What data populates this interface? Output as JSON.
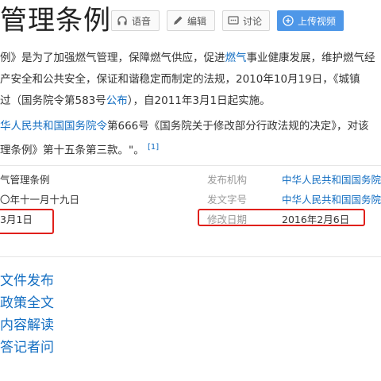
{
  "header": {
    "title": "管理条例",
    "buttons": {
      "voice": "语音",
      "edit": "编辑",
      "discuss": "讨论",
      "upload": "上传视频"
    }
  },
  "intro": {
    "line1": "例》是为了加强燃气管理，保障燃气供应，促进燃气事业健康发展，维护燃气经",
    "line1_link": "燃气",
    "line2": "产安全和公共安全，保证和谐稳定而制定的法规，2010年10月19日，《城镇",
    "line3_a": "过（国务院令第583号",
    "line3_link": "公布",
    "line3_b": "），自2011年3月1日起实施。"
  },
  "amend": {
    "link": "华人民共和国国务院令",
    "text1": "第666号《国务院关于修改部分行政法规的决定》，对该",
    "text2": "理条例》第十五条第三款。\"。",
    "ref": "[1]"
  },
  "info": {
    "left": [
      "气管理条例",
      "〇年十一月十九日",
      "3月1日"
    ],
    "right_labels": [
      "发布机构",
      "发文字号",
      "修改日期"
    ],
    "right_values": [
      "中华人民共和国国务院令",
      "中华人民共和国国务院令",
      "2016年2月6日"
    ]
  },
  "related_links": [
    "文件发布",
    "政策全文",
    "内容解读",
    "答记者问"
  ]
}
